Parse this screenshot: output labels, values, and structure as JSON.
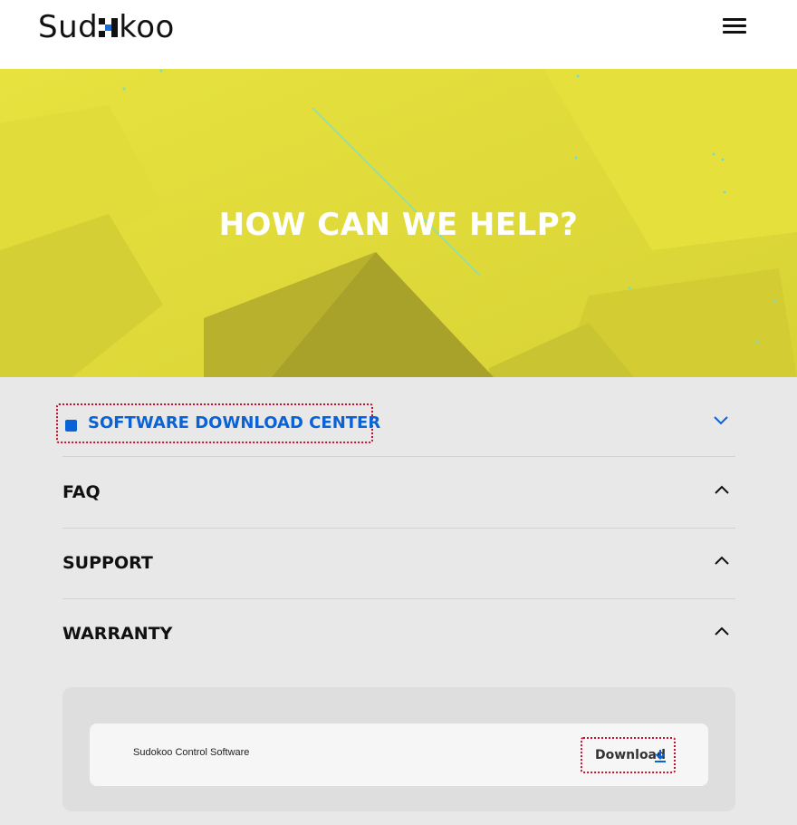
{
  "header": {
    "logo_left": "Sud",
    "logo_right": "koo",
    "menu_icon": "hamburger-menu-icon"
  },
  "hero": {
    "title": "HOW CAN WE HELP?"
  },
  "accordion": {
    "items": [
      {
        "label": "SOFTWARE DOWNLOAD CENTER",
        "expanded": true,
        "icon": "chevron-down-icon"
      },
      {
        "label": "FAQ",
        "expanded": false,
        "icon": "chevron-up-icon"
      },
      {
        "label": "SUPPORT",
        "expanded": false,
        "icon": "chevron-up-icon"
      },
      {
        "label": "WARRANTY",
        "expanded": false,
        "icon": "chevron-up-icon"
      }
    ]
  },
  "downloads": {
    "items": [
      {
        "name": "Sudokoo Control Software",
        "action_label": "Download",
        "icon": "download-icon"
      }
    ]
  },
  "colors": {
    "accent_blue": "#0a63d6",
    "hero_yellow": "#dbd63a",
    "focus_outline": "#c8102e"
  }
}
